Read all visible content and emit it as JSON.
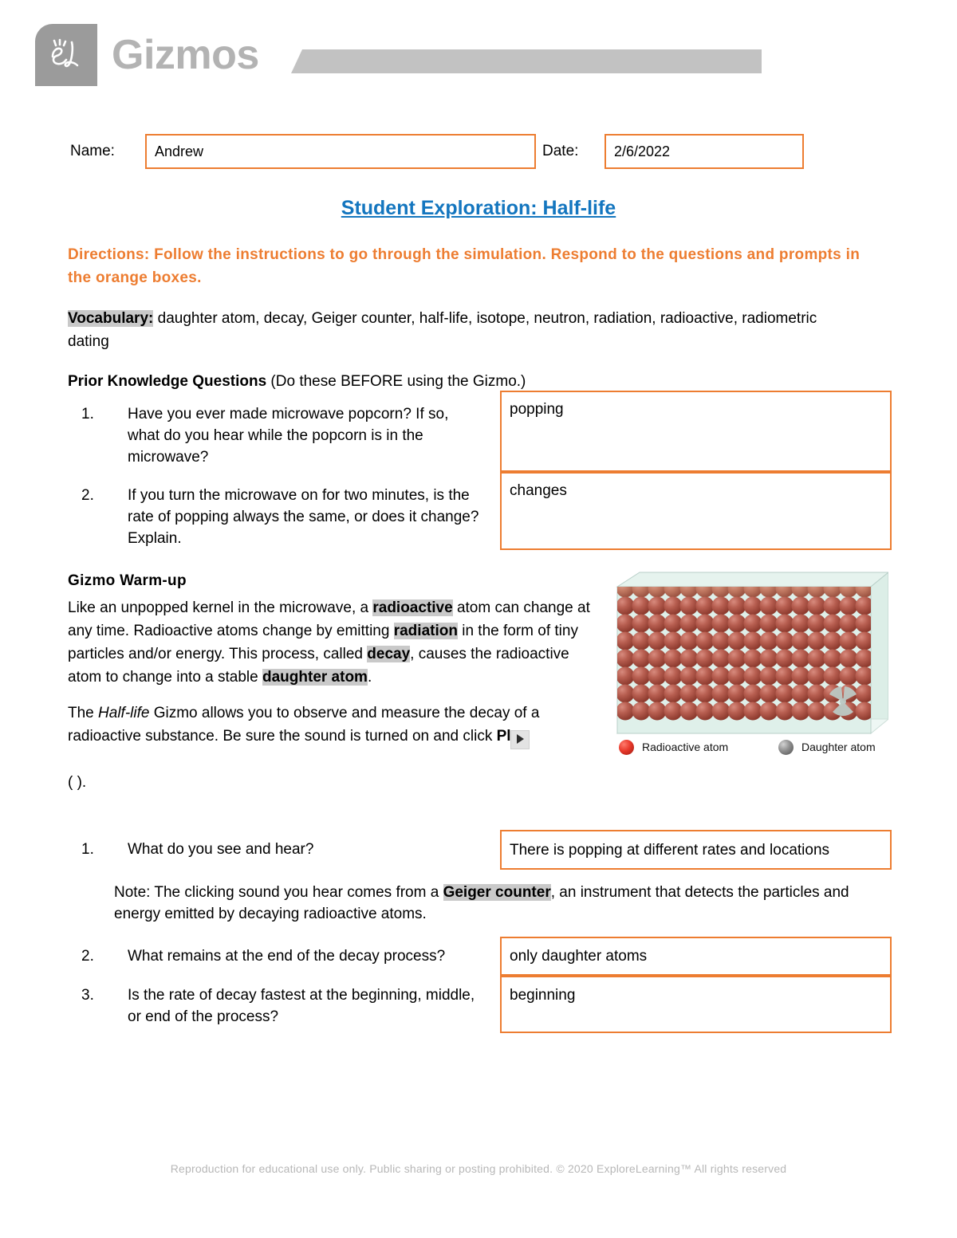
{
  "brand": {
    "logo_icon": "gizmos-el-monogram-icon",
    "wordmark": "Gizmos"
  },
  "header": {
    "name_label": "Name:",
    "name_value": "Andrew",
    "date_label": "Date:",
    "date_value": "2/6/2022"
  },
  "title": "Student Exploration: Half-life",
  "directions": "Directions: Follow the instructions to go through the simulation. Respond to the questions and prompts in the orange boxes.",
  "vocabulary": {
    "label": "Vocabulary:",
    "terms": " daughter atom, decay, Geiger counter, half-life, isotope, neutron, radiation, radioactive, radiometric dating"
  },
  "prior_knowledge": {
    "heading_bold": "Prior Knowledge Questions",
    "heading_rest": " (Do these BEFORE using the Gizmo.)",
    "questions": [
      {
        "num": "1.",
        "text": "Have you ever made microwave popcorn? If so, what do you hear while the popcorn is in the microwave?",
        "answer": "popping"
      },
      {
        "num": "2.",
        "text": "If you turn the microwave on for two minutes, is the rate of popping always the same, or does it change? Explain.",
        "answer": "changes"
      }
    ]
  },
  "warmup": {
    "heading": "Gizmo Warm-up",
    "p1_a": "Like an unpopped kernel in the microwave, a ",
    "p1_t1": "radioactive",
    "p1_b": " atom can change at any time. Radioactive atoms change by emitting ",
    "p1_t2": "radiation",
    "p1_c": " in the form of tiny particles and/or energy. This process, called ",
    "p1_t3": "decay",
    "p1_d": ", causes the radioactive atom to change into a stable ",
    "p1_t4": "daughter atom",
    "p1_e": ".",
    "p2_a": "The ",
    "p2_italic": "Half-life",
    "p2_b": " Gizmo allows you to observe and measure the decay of a radioactive substance. Be sure the sound is turned on and click ",
    "p2_bold": "Play",
    "p2_paren": "(        )."
  },
  "gizmo_image": {
    "alt": "half-life-simulation-box",
    "box_fill": "#d8efe6",
    "atom_color": "#b4564a",
    "grid_columns": 16,
    "grid_rows": 8,
    "radiation_symbol": "radiation-trefoil-icon",
    "legend": [
      {
        "icon": "red-sphere-icon",
        "label": "Radioactive atom"
      },
      {
        "icon": "grey-sphere-icon",
        "label": "Daughter atom"
      }
    ]
  },
  "warmup_questions": [
    {
      "num": "1.",
      "text": "What do you see and hear?",
      "answer": "There is popping at different rates and locations"
    },
    {
      "num": "2.",
      "text": "What remains at the end of the decay process?",
      "answer": "only daughter atoms"
    },
    {
      "num": "3.",
      "text": "Is the rate of decay fastest at the beginning, middle, or end of the process?",
      "answer": "beginning"
    }
  ],
  "note": {
    "a": "Note: The clicking sound you hear comes from a ",
    "term": "Geiger counter",
    "b": ", an instrument that detects the particles and energy emitted by decaying radioactive atoms."
  },
  "footer": "Reproduction for educational use only. Public sharing or posting prohibited. © 2020 ExploreLearning™ All rights reserved",
  "colors": {
    "accent_orange": "#ED7D31",
    "title_blue": "#1476BF",
    "logo_grey": "#9b9b9b",
    "highlight_grey": "#c9c9c9"
  }
}
